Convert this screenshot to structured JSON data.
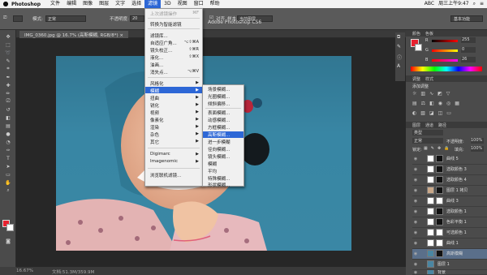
{
  "menubar": {
    "app": "Photoshop",
    "items": [
      "文件",
      "编辑",
      "图像",
      "图层",
      "文字",
      "选择",
      "滤镜",
      "3D",
      "视图",
      "窗口",
      "帮助"
    ],
    "active_index": 6,
    "status": [
      "ABC",
      "周三上午9:47"
    ]
  },
  "app_title": "Adobe Photoshop CS6",
  "options": {
    "mode_label": "模式:",
    "mode_value": "正常",
    "opacity_label": "不透明度:",
    "opacity_value": "20",
    "flow_label": "对齐",
    "sample_label": "样本:",
    "sample_value": "当前图层",
    "essentials": "基本功能"
  },
  "doc": {
    "tab": "IMG_0360.jpg @ 16.7% (高斯模糊, RGB/8*) ×",
    "zoom": "16.67%",
    "size": "文档:51.3M/359.9M"
  },
  "filter_menu": {
    "items": [
      {
        "label": "上次滤镜操作",
        "shortcut": "⌘F",
        "disabled": true
      },
      {
        "label": "转换为智能滤镜"
      },
      {
        "label": "滤镜库..."
      },
      {
        "label": "自适应广角...",
        "shortcut": "⌥⇧⌘A"
      },
      {
        "label": "镜头校正...",
        "shortcut": "⇧⌘R"
      },
      {
        "label": "液化...",
        "shortcut": "⇧⌘X"
      },
      {
        "label": "油画..."
      },
      {
        "label": "消失点...",
        "shortcut": "⌥⌘V"
      },
      {
        "label": "风格化"
      },
      {
        "label": "模糊",
        "active": true
      },
      {
        "label": "扭曲"
      },
      {
        "label": "锐化"
      },
      {
        "label": "视频"
      },
      {
        "label": "像素化"
      },
      {
        "label": "渲染"
      },
      {
        "label": "杂色"
      },
      {
        "label": "其它"
      },
      {
        "label": "Digimarc"
      },
      {
        "label": "Imagenomic"
      },
      {
        "label": "浏览联机滤镜..."
      }
    ]
  },
  "blur_menu": {
    "items": [
      "场景模糊...",
      "光圈模糊...",
      "倾斜偏移...",
      "表面模糊...",
      "动感模糊...",
      "方框模糊...",
      "高斯模糊...",
      "进一步模糊",
      "径向模糊...",
      "镜头模糊...",
      "模糊",
      "平均",
      "特殊模糊...",
      "形状模糊..."
    ],
    "active_index": 6
  },
  "color_panel": {
    "tabs": [
      "颜色",
      "色板"
    ],
    "r": "255",
    "g": "0",
    "b": "26"
  },
  "adjust_panel": {
    "tabs": [
      "调整",
      "样式"
    ],
    "title": "添加调整"
  },
  "layers_panel": {
    "tabs": [
      "图层",
      "通道",
      "路径"
    ],
    "kind": "类型",
    "blend": "正常",
    "opacity_label": "不透明度:",
    "opacity": "100%",
    "lock_label": "锁定:",
    "fill_label": "填充:",
    "fill": "100%",
    "layers": [
      "曲线 5",
      "选取颜色 3",
      "选取颜色 4",
      "图层 1 拷贝",
      "曲线 3",
      "选取颜色 1",
      "色彩平衡 1",
      "可选颜色 1",
      "曲线 1",
      "高斯模糊",
      "图层 1",
      "背景"
    ]
  }
}
